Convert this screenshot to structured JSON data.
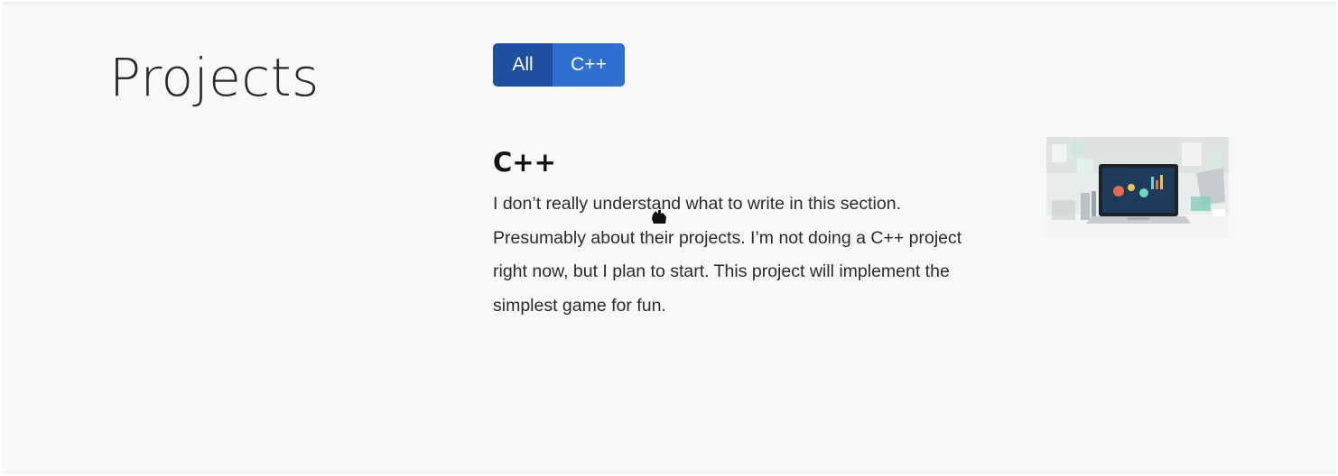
{
  "page": {
    "title": "Projects"
  },
  "filters": {
    "items": [
      {
        "label": "All",
        "active": true
      },
      {
        "label": "C++",
        "active": false
      }
    ]
  },
  "project": {
    "title": "C++",
    "description": "I don’t really understand what to write in this section. Presumably about their projects. I’m not doing a C++ project right now, but I plan to start. This project will implement the simplest game for fun."
  },
  "colors": {
    "background": "#f8f8f8",
    "filter_active": "#1f4fa0",
    "filter_normal": "#2e6fd0"
  },
  "icons": {
    "thumbnail": "laptop-image",
    "cursor": "hand-pointer-icon"
  }
}
